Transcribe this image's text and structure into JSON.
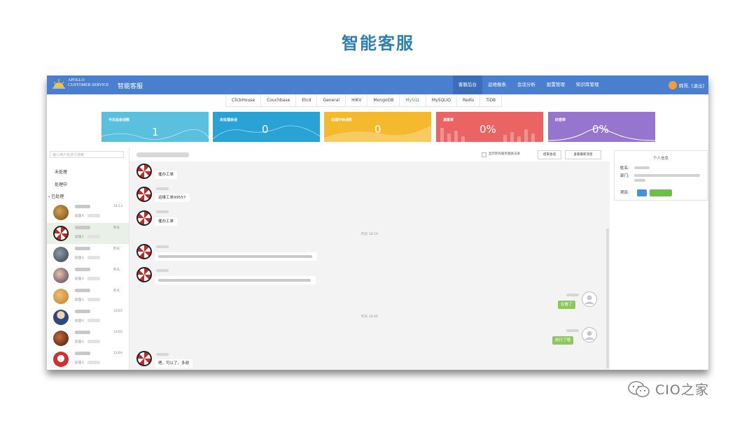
{
  "slide_title": "智能客服",
  "app": {
    "brand_line1": "APOLLO",
    "brand_line2": "CUSTOMER SERVICE",
    "brand_cn": "智能客服",
    "nav": [
      {
        "label": "客服后台",
        "active": true
      },
      {
        "label": "运维报表",
        "active": false
      },
      {
        "label": "会话分析",
        "active": false
      },
      {
        "label": "配置管理",
        "active": false
      },
      {
        "label": "知识库管理",
        "active": false
      }
    ],
    "user_label": "韩哥,",
    "logout_label": "[退出]",
    "tabs": [
      {
        "label": "ClickHouse",
        "active": false
      },
      {
        "label": "Couchbase",
        "active": false
      },
      {
        "label": "Etcd",
        "active": false
      },
      {
        "label": "General",
        "active": false
      },
      {
        "label": "HIKV",
        "active": false
      },
      {
        "label": "MongoDB",
        "active": false
      },
      {
        "label": "MySQL",
        "active": true
      },
      {
        "label": "MySQLIO",
        "active": false
      },
      {
        "label": "Redis",
        "active": false
      },
      {
        "label": "TiDB",
        "active": false
      }
    ],
    "stats": [
      {
        "label": "今日总会话数",
        "value": "1",
        "color": "#5bc0de"
      },
      {
        "label": "未处理会话",
        "value": "0",
        "color": "#29a3d6"
      },
      {
        "label": "处理中会话数",
        "value": "0",
        "color": "#f5b92e"
      },
      {
        "label": "满意率",
        "value": "0%",
        "color": "#ea6464"
      },
      {
        "label": "好感率",
        "value": "0%",
        "color": "#9575cd"
      }
    ],
    "sidebar": {
      "search_placeholder": "输入用户名进行搜索",
      "unprocessed": "未处理",
      "processing": "处理中",
      "processed": "已处理",
      "handler_prefix": "处理人",
      "conversations": [
        {
          "time": "14:13"
        },
        {
          "time": "昨天"
        },
        {
          "time": "昨天"
        },
        {
          "time": "昨天"
        },
        {
          "time": "昨天"
        },
        {
          "time": "12/07"
        },
        {
          "time": "12/05"
        },
        {
          "time": "12/04"
        }
      ]
    },
    "chat": {
      "show_all_label": "显示所有服务相关记录",
      "close_button": "结束会话",
      "latest_button": "查看最新消息",
      "messages": {
        "m1": "催办工单",
        "m2": "运维工单99557",
        "m3": "催办工单",
        "sep1": "昨天 18:19",
        "sep2": "昨天 18:46",
        "agent1": "在看了",
        "agent2": "执行了哦",
        "m_last": "嗯，可以了，多谢"
      }
    },
    "info": {
      "title": "个人信息",
      "name_label": "姓名:",
      "dept_label": "部门:",
      "project_label": "项目:"
    }
  },
  "footer": {
    "text": "CIO之家",
    "icon": "wechat-icon"
  }
}
